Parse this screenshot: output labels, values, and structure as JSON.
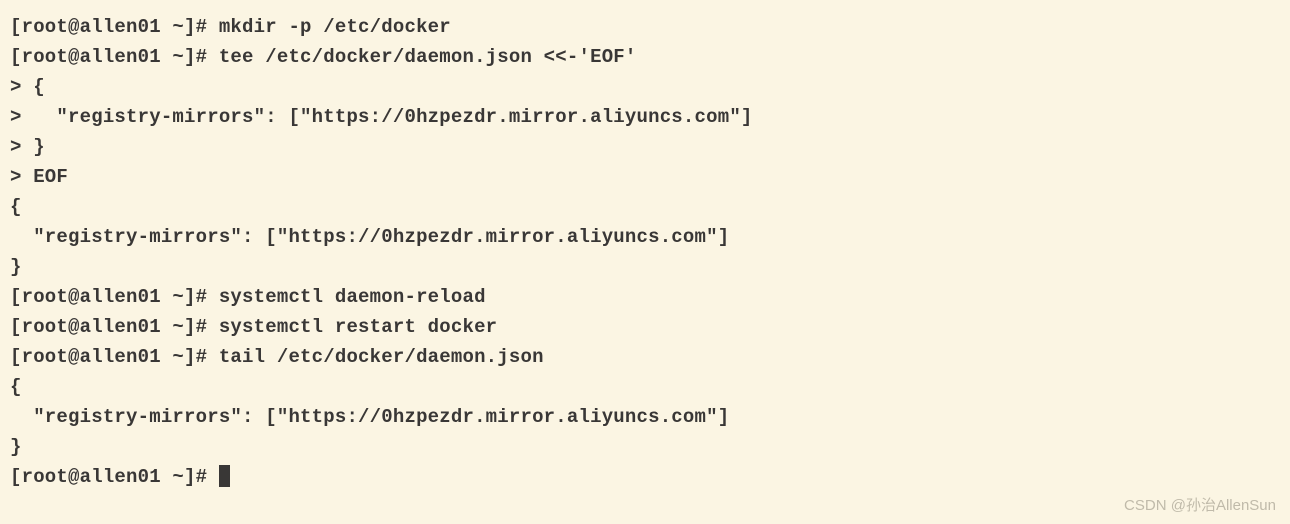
{
  "terminal": {
    "lines": [
      "[root@allen01 ~]# mkdir -p /etc/docker",
      "[root@allen01 ~]# tee /etc/docker/daemon.json <<-'EOF'",
      "> {",
      ">   \"registry-mirrors\": [\"https://0hzpezdr.mirror.aliyuncs.com\"]",
      "> }",
      "> EOF",
      "{",
      "  \"registry-mirrors\": [\"https://0hzpezdr.mirror.aliyuncs.com\"]",
      "}",
      "[root@allen01 ~]# systemctl daemon-reload",
      "[root@allen01 ~]# systemctl restart docker",
      "[root@allen01 ~]# tail /etc/docker/daemon.json",
      "{",
      "  \"registry-mirrors\": [\"https://0hzpezdr.mirror.aliyuncs.com\"]",
      "}"
    ],
    "prompt_final": "[root@allen01 ~]# "
  },
  "watermark": "CSDN @孙治AllenSun"
}
